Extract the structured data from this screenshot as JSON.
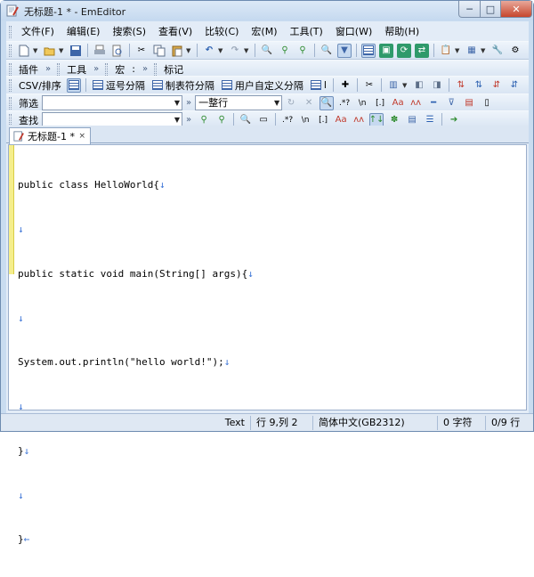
{
  "window": {
    "title": "无标题-1 * - EmEditor",
    "min_glyph": "─",
    "max_glyph": "□",
    "close_glyph": "✕"
  },
  "menu": [
    "文件(F)",
    "编辑(E)",
    "搜索(S)",
    "查看(V)",
    "比较(C)",
    "宏(M)",
    "工具(T)",
    "窗口(W)",
    "帮助(H)"
  ],
  "toolbar2": {
    "plugins_label": "插件",
    "tools_label": "工具",
    "macro_label": "宏",
    "macro_suffix": ":",
    "marker_label": "标记"
  },
  "toolbar3": {
    "csv_label": "CSV/排序",
    "comma_label": "逗号分隔",
    "tab_label": "制表符分隔",
    "custom_label": "用户自定义分隔",
    "pipe_label": "l"
  },
  "filterbar": {
    "label": "筛选",
    "value": "",
    "mode_value": "一整行"
  },
  "findbar": {
    "label": "查找",
    "value": ""
  },
  "tab": {
    "label": "无标题-1 *",
    "close_glyph": "×"
  },
  "editor": {
    "lines": [
      {
        "text": "public class HelloWorld{",
        "eol": "↓"
      },
      {
        "text": "",
        "eol": "↓"
      },
      {
        "text": "public static void main(String[] args){",
        "eol": "↓"
      },
      {
        "text": "",
        "eol": "↓"
      },
      {
        "text": "System.out.println(\"hello world!\");",
        "eol": "↓"
      },
      {
        "text": "",
        "eol": "↓"
      },
      {
        "text": "}",
        "eol": "↓"
      },
      {
        "text": "",
        "eol": "↓"
      },
      {
        "text": "}",
        "eol": "←"
      }
    ]
  },
  "status": {
    "mode": "Text",
    "position": "行 9,列 2",
    "encoding": "简体中文(GB2312)",
    "chars": "0 字符",
    "lines": "0/9 行"
  },
  "colors": {
    "accent": "#3e66a8",
    "gutter": "#f5ee8c",
    "eol_mark": "#3b74d6"
  }
}
